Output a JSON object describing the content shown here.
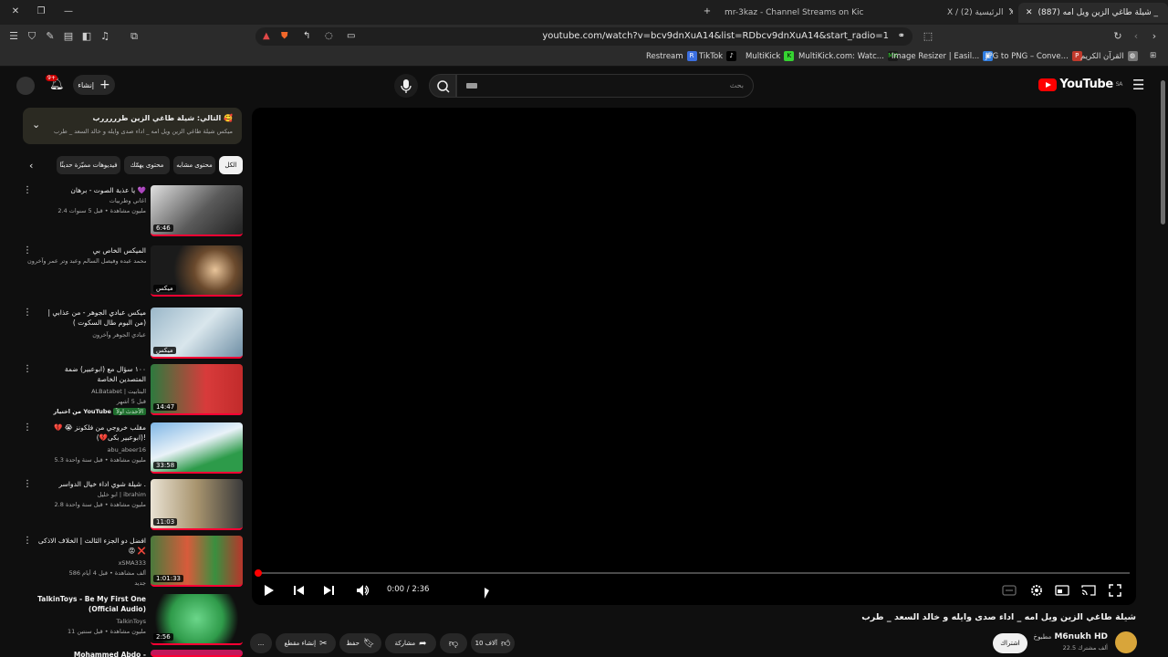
{
  "browser": {
    "tabs": [
      {
        "label": "mr-3kaz - Channel Streams on Kick \\"
      },
      {
        "label": "X / الرئيسية (2)"
      },
      {
        "label": "(887) شيلة طاغي الزين ويل امه _"
      }
    ],
    "new_tab": "+",
    "url": "youtube.com/watch?v=bcv9dnXuA14&list=RDbcv9dnXuA14&start_radio=1",
    "bookmarks": [
      {
        "label": "Restream",
        "icon": "R",
        "color": "#3b6fe0"
      },
      {
        "label": "TikTok",
        "icon": "♪",
        "color": "#000000"
      },
      {
        "label": "MultiKick",
        "icon": "K",
        "color": "#35d331"
      },
      {
        "label": "MultiKick.com: Watc...",
        "icon": "MK",
        "color": "#1a1a1a"
      },
      {
        "label": "Image Resizer | Easil...",
        "icon": "▣",
        "color": "#2f7de1"
      },
      {
        "label": "JPG to PNG – Conve...",
        "icon": "P",
        "color": "#c0392b"
      },
      {
        "label": "القرآن الكريم",
        "icon": "◍",
        "color": "#777777"
      }
    ]
  },
  "masthead": {
    "logo": "YouTube",
    "logo_region": "SA",
    "search_placeholder": "بحث",
    "create_label": "إنشاء",
    "notif_count": "9+"
  },
  "playlist": {
    "title": "التالي: شيلة طاغي الزين طرررررب 🥰",
    "subtitle": "ميكس شيلة طاغي الزين ويل امه _ اداء صدى وايله و خالد السعد _ طرب"
  },
  "chips": [
    "الكل",
    "محتوى مشابه",
    "محتوى يهمّك",
    "فيديوهات مميّزة حديثًا"
  ],
  "recommendations": [
    {
      "title": "يا عذبة الصوت - برهان 💜",
      "line1": "اغاني وطربيات",
      "line2": "2.4 مليون مشاهدة • قبل 5 سنوات",
      "line3": "",
      "duration": "6:46"
    },
    {
      "title": "الميكس الخاص بي",
      "line1": "محمد عبده وفيصل السالم وعبد وتر عمر وآخرون",
      "line2": "",
      "line3": "",
      "duration": "ميكس"
    },
    {
      "title": "ميكس عبادي الجوهر - من عذابي | (من البوم طال السكوت )",
      "line1": "عبادي الجوهر وآخرون",
      "line2": "",
      "line3": "",
      "duration": "ميكس"
    },
    {
      "title": "١٠٠ سؤال مع (ابوعبير) ضمة المتصدين الخاصة",
      "line1": "ALBatabet | البتابيت",
      "line2": "قبل 5 أشهر",
      "line3": "من اختيار YouTube",
      "badge": "الأحدث اولاً",
      "duration": "14:47"
    },
    {
      "title": "مقلب خروجي من فلكونز 😭 💔 (ابوعبير بكى💔)!",
      "line1": "abu_abeer16",
      "line2": "5.3 مليون مشاهدة • قبل سنة واحدة",
      "line3": "",
      "duration": "33:58"
    },
    {
      "title": "شيلة شوي اداء خيال الدواسر .",
      "line1": "ابو خليل | ibrahim",
      "line2": "2.8 مليون مشاهدة • قبل سنة واحدة",
      "line3": "",
      "duration": "11:03"
    },
    {
      "title": "افضل دو الجزء الثالث | الخلاف الاذكى 😡 ❌",
      "line1": "xSMA333",
      "line2": "586 ألف مشاهدة • قبل 4 أيام",
      "line3": "جديد",
      "duration": "1:01:33"
    },
    {
      "title": "TalkinToys - Be My First One (Official Audio)",
      "line1": "TalkinToys",
      "line2": "11 مليون مشاهدة • قبل سنتين",
      "line3": "",
      "duration": "2:56"
    },
    {
      "title": "Mohammed Abdo - Ekhtalafna",
      "line1": "",
      "line2": "",
      "line3": "",
      "duration": ""
    }
  ],
  "player": {
    "time": "0:00 / 2:36",
    "progress": 0.0
  },
  "video": {
    "title": "شيلة طاغي الزين ويل امه _ اداء صدى وايله و خالد السعد _ طرب",
    "channel": "M6nukh HD",
    "channel_badge": "مطبوخ",
    "subscribers": "22.5 ألف مشترك",
    "subscribe_label": "اشتراك",
    "likes": "10 آلاف",
    "share_label": "مشاركة",
    "save_label": "حفظ",
    "clip_label": "إنشاء مقطع",
    "more_label": "..."
  }
}
